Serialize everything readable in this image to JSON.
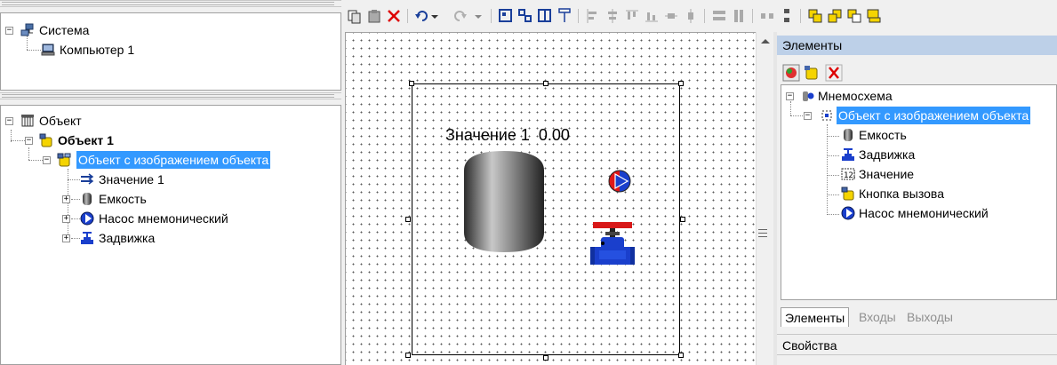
{
  "system_tree": {
    "root": "Система",
    "child": "Компьютер 1"
  },
  "object_tree": {
    "root": "Объект",
    "object1": "Объект 1",
    "selected": "Объект с изображением объекта",
    "children": [
      "Значение 1",
      "Емкость",
      "Насос мнемонический",
      "Задвижка"
    ]
  },
  "canvas": {
    "value_label": "Значение 1",
    "value_number": "0.00"
  },
  "elements_panel": {
    "title": "Элементы",
    "tree_root": "Мнемосхема",
    "tree_selected": "Объект с изображением объекта",
    "items": [
      "Емкость",
      "Задвижка",
      "Значение",
      "Кнопка вызова",
      "Насос мнемонический"
    ],
    "tabs": [
      "Элементы",
      "Входы",
      "Выходы"
    ],
    "properties_title": "Свойства"
  },
  "colors": {
    "selection": "#3399ff",
    "panel_header": "#bdd0e8"
  }
}
